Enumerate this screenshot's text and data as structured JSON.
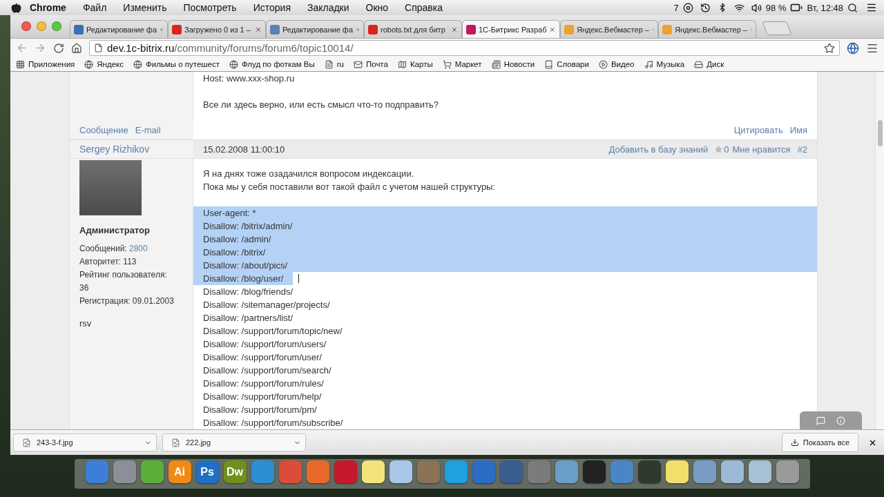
{
  "menubar": {
    "app": "Chrome",
    "menus": [
      "Файл",
      "Изменить",
      "Посмотреть",
      "История",
      "Закладки",
      "Окно",
      "Справка"
    ],
    "status": {
      "badge_count": "7",
      "battery": "98 %",
      "clock": "Вт, 12:48"
    }
  },
  "tabs": [
    {
      "title": "Редактирование фа",
      "selected": false
    },
    {
      "title": "Загружено 0 из 1 –",
      "selected": false
    },
    {
      "title": "Редактирование фа",
      "selected": false
    },
    {
      "title": "robots.txt для битр",
      "selected": false
    },
    {
      "title": "1С-Битрикс Разраб",
      "selected": true
    },
    {
      "title": "Яндекс.Вебмастер –",
      "selected": false
    },
    {
      "title": "Яндекс.Вебмастер –",
      "selected": false
    }
  ],
  "address_bar": {
    "host": "dev.1c-bitrix.ru",
    "path": "/community/forums/forum6/topic10014/"
  },
  "bookmarks": [
    "Приложения",
    "Яндекс",
    "Фильмы о путешест",
    "Флуд по фоткам Вы",
    "ru",
    "Почта",
    "Карты",
    "Маркет",
    "Новости",
    "Словари",
    "Видео",
    "Музыка",
    "Диск"
  ],
  "previous_post": {
    "lines": [
      "Host: www.xxx-shop.ru",
      "Все ли здесь верно, или есть смысл что-то подправить?"
    ],
    "author_links": [
      "Сообщение",
      "E-mail"
    ],
    "actions": [
      "Цитировать",
      "Имя"
    ]
  },
  "post": {
    "author": "Sergey Rizhikov",
    "date": "15.02.2008 11:00:10",
    "knowledge_link": "Добавить в базу знаний",
    "likes": "0",
    "like_label": "Мне нравится",
    "number": "#2",
    "role": "Администратор",
    "stats": [
      {
        "label": "Сообщений:",
        "value": "2800",
        "kind": "link"
      },
      {
        "label": "Авторитет:",
        "value": "113",
        "kind": "inline"
      },
      {
        "label": "Рейтинг пользователя:",
        "value": "36",
        "kind": "stacked"
      },
      {
        "label": "Регистрация:",
        "value": "09.01.2003",
        "kind": "inline"
      }
    ],
    "signature": "rsv",
    "text_lines": [
      "Я на днях тоже озадачился вопросом индексации.",
      "Пока мы у себя поставили вот такой файл с учетом нашей структуры:"
    ],
    "code_lines": [
      {
        "text": "User-agent: *",
        "selected": true
      },
      {
        "text": "Disallow: /bitrix/admin/",
        "selected": true
      },
      {
        "text": "Disallow: /admin/",
        "selected": true
      },
      {
        "text": "Disallow: /bitrix/",
        "selected": true
      },
      {
        "text": "Disallow: /about/pics/",
        "selected": true
      },
      {
        "text": "Disallow: /blog/user/",
        "selected": true
      },
      {
        "text": "Disallow: /blog/friends/",
        "selected": false
      },
      {
        "text": "Disallow: /sitemanager/projects/",
        "selected": false
      },
      {
        "text": "Disallow: /partners/list/",
        "selected": false
      },
      {
        "text": "Disallow: /support/forum/topic/new/",
        "selected": false
      },
      {
        "text": "Disallow: /support/forum/users/",
        "selected": false
      },
      {
        "text": "Disallow: /support/forum/user/",
        "selected": false
      },
      {
        "text": "Disallow: /support/forum/search/",
        "selected": false
      },
      {
        "text": "Disallow: /support/forum/rules/",
        "selected": false
      },
      {
        "text": "Disallow: /support/forum/help/",
        "selected": false
      },
      {
        "text": "Disallow: /support/forum/pm/",
        "selected": false
      },
      {
        "text": "Disallow: /support/forum/subscribe/",
        "selected": false
      }
    ]
  },
  "downloads": {
    "items": [
      "243-3-f.jpg",
      "222.jpg"
    ],
    "show_all": "Показать все"
  },
  "dock": {
    "apps": [
      {
        "color": "#3d7fd8"
      },
      {
        "color": "#8a8f98"
      },
      {
        "color": "#5cae3a"
      },
      {
        "label": "Ai",
        "color": "#f08a16"
      },
      {
        "label": "Ps",
        "color": "#1f6fc2"
      },
      {
        "label": "Dw",
        "color": "#6f8f1e"
      },
      {
        "color": "#2c8fd6"
      },
      {
        "color": "#dd4b39"
      },
      {
        "color": "#e8692a"
      },
      {
        "color": "#c8182b"
      },
      {
        "color": "#f3e37a"
      },
      {
        "color": "#a9c6e8"
      },
      {
        "color": "#8b7355"
      },
      {
        "color": "#1da1e0"
      },
      {
        "color": "#2b6cc4"
      },
      {
        "color": "#3a5f8f"
      },
      {
        "color": "#7b7b7b"
      },
      {
        "color": "#6a9ec7"
      },
      {
        "color": "#222222"
      },
      {
        "color": "#4a86c5"
      },
      {
        "color": "#2f3a2f"
      },
      {
        "color": "#f1de6b"
      },
      {
        "color": "#7b9cc2"
      },
      {
        "color": "#9cbad6"
      },
      {
        "color": "#a7c0d6"
      },
      {
        "color": "#9a9a9a"
      }
    ]
  }
}
